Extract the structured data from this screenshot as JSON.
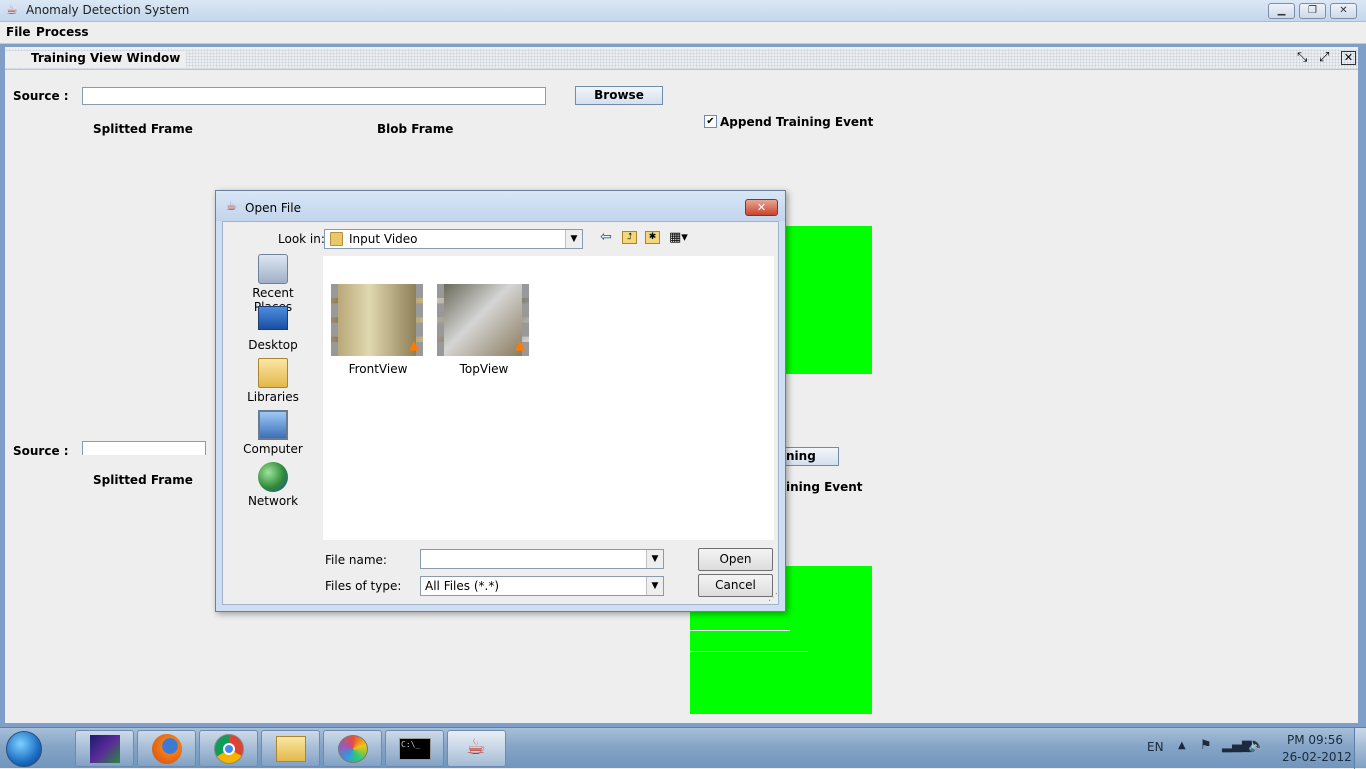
{
  "app": {
    "title": "Anomaly Detection System",
    "window_controls": [
      "minimize",
      "restore",
      "close"
    ]
  },
  "menubar": {
    "items": [
      "File",
      "Process"
    ]
  },
  "internal_frame": {
    "title": "Training View Window",
    "controls": [
      "iconify",
      "maximize",
      "close"
    ],
    "section1": {
      "source_label": "Source :",
      "source_value": "",
      "browse_label": "Browse",
      "splitted_frame_label": "Splitted Frame",
      "blob_frame_label": "Blob Frame",
      "append_label": "Append Training Event",
      "append_checked": true
    },
    "section2": {
      "source_label": "Source :",
      "splitted_frame_label": "Splitted Frame",
      "button_partial": "ning",
      "append_partial": "ining Event"
    },
    "accent_color": "#00ff00"
  },
  "dialog": {
    "title": "Open File",
    "look_in_label": "Look in:",
    "look_in_value": "Input Video",
    "places": [
      {
        "label": "Recent Places",
        "icon": "recent-places-icon"
      },
      {
        "label": "Desktop",
        "icon": "desktop-icon"
      },
      {
        "label": "Libraries",
        "icon": "libraries-icon"
      },
      {
        "label": "Computer",
        "icon": "computer-icon"
      },
      {
        "label": "Network",
        "icon": "network-icon"
      }
    ],
    "files": [
      {
        "name": "FrontView",
        "icon": "video-file-icon"
      },
      {
        "name": "TopView",
        "icon": "video-file-icon"
      }
    ],
    "file_name_label": "File name:",
    "file_name_value": "",
    "files_of_type_label": "Files of type:",
    "files_of_type_value": "All Files (*.*)",
    "open_label": "Open",
    "cancel_label": "Cancel"
  },
  "taskbar": {
    "apps": [
      "start-orb-icon",
      "visual-studio-icon",
      "firefox-icon",
      "chrome-icon",
      "explorer-icon",
      "paint-icon",
      "cmd-icon",
      "java-icon"
    ],
    "language": "EN",
    "time": "PM 09:56",
    "date": "26-02-2012"
  }
}
